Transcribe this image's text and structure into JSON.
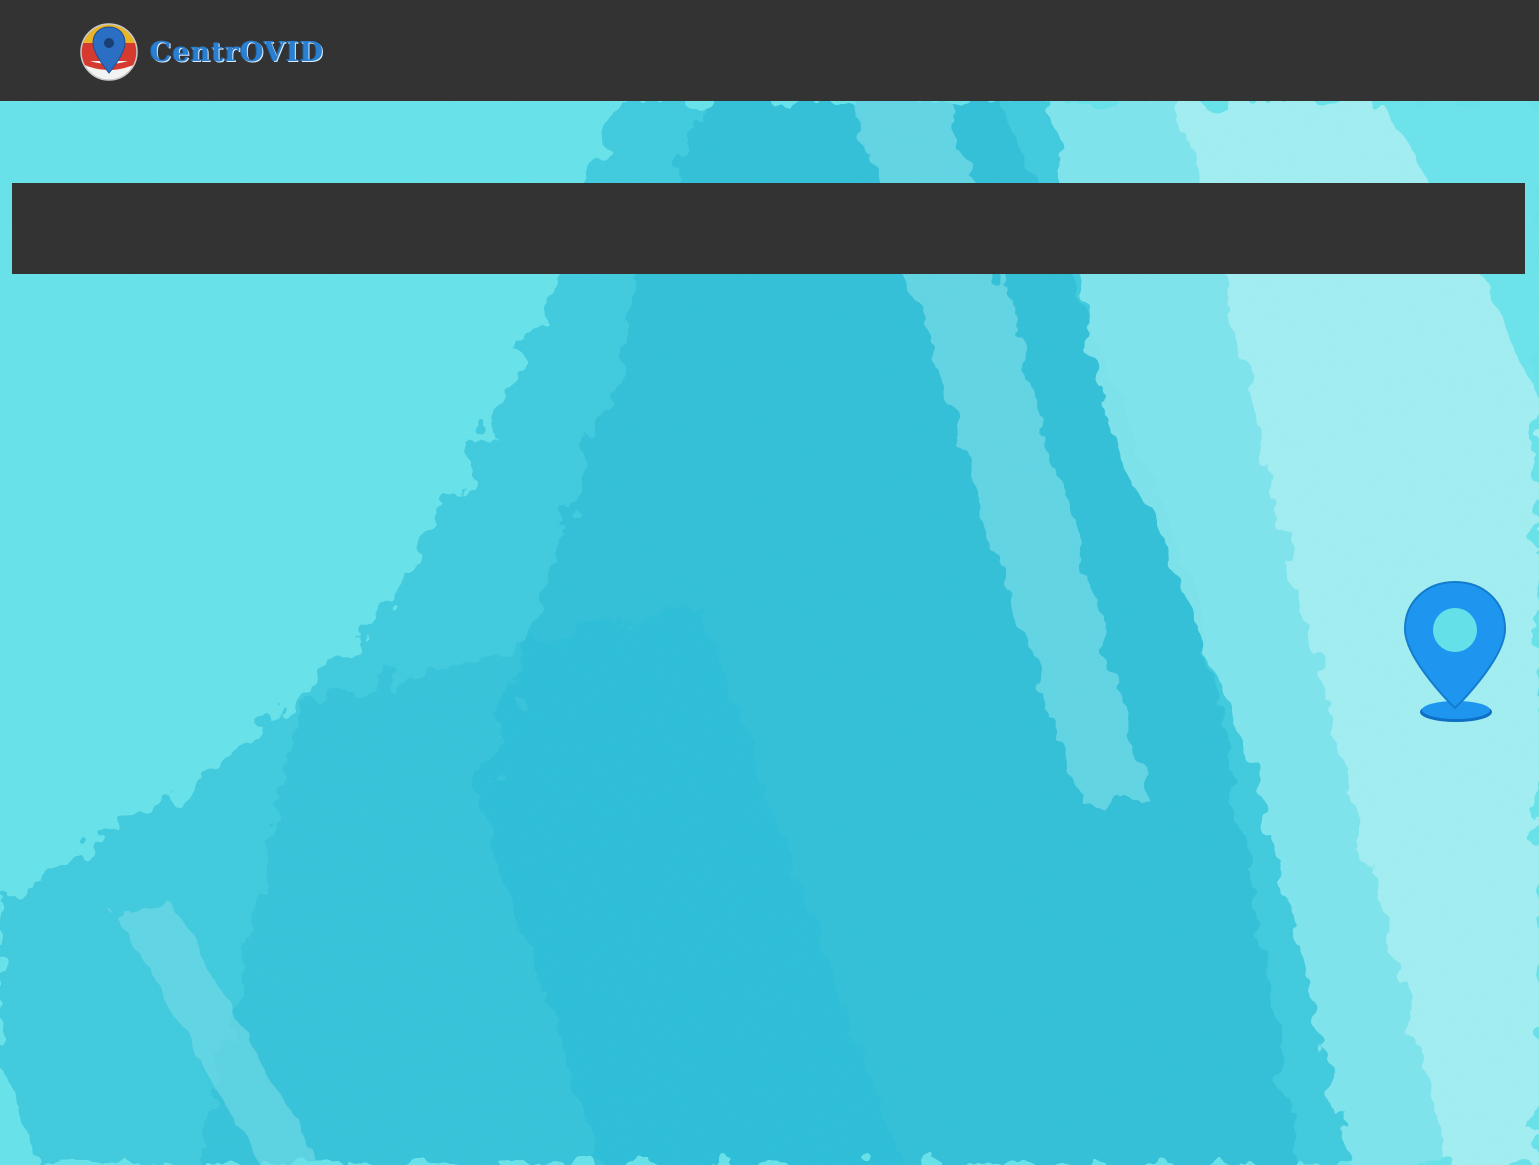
{
  "header": {
    "brand_name": "CentrOVID",
    "logo_icon": "map-pin-logo-icon",
    "background_color": "#333333",
    "brand_color": "#2a7fd0"
  },
  "hero": {
    "background_color": "#63e0e8",
    "banner_color": "#333333",
    "pin_icon": "location-pin-icon",
    "pin_color": "#1e96f0"
  }
}
